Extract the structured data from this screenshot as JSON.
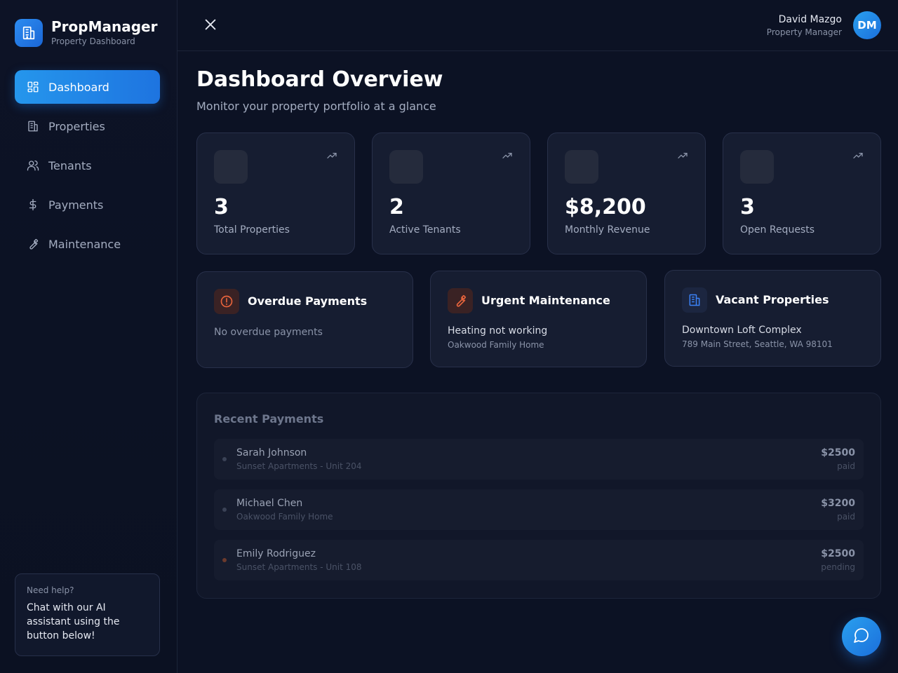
{
  "brand": {
    "title": "PropManager",
    "subtitle": "Property Dashboard",
    "logo_icon": "building-icon"
  },
  "nav": {
    "items": [
      {
        "label": "Dashboard",
        "icon": "grid-icon",
        "active": true
      },
      {
        "label": "Properties",
        "icon": "building-icon",
        "active": false
      },
      {
        "label": "Tenants",
        "icon": "users-icon",
        "active": false
      },
      {
        "label": "Payments",
        "icon": "dollar-icon",
        "active": false
      },
      {
        "label": "Maintenance",
        "icon": "wrench-icon",
        "active": false
      }
    ]
  },
  "help": {
    "title": "Need help?",
    "text": "Chat with our AI assistant using the button below!"
  },
  "header": {
    "close_icon": "close-icon",
    "user_name": "David Mazgo",
    "user_role": "Property Manager",
    "avatar_initials": "DM"
  },
  "page": {
    "title": "Dashboard Overview",
    "subtitle": "Monitor your property portfolio at a glance"
  },
  "stats": [
    {
      "value": "3",
      "label": "Total Properties"
    },
    {
      "value": "2",
      "label": "Active Tenants"
    },
    {
      "value": "$8,200",
      "label": "Monthly Revenue"
    },
    {
      "value": "3",
      "label": "Open Requests"
    }
  ],
  "alerts": {
    "overdue": {
      "title": "Overdue Payments",
      "body": "No overdue payments",
      "icon": "alert-circle-icon",
      "color": "#e8643c"
    },
    "maintenance": {
      "title": "Urgent Maintenance",
      "line1": "Heating not working",
      "line2": "Oakwood Family Home",
      "icon": "wrench-icon",
      "color": "#e8643c"
    },
    "vacant": {
      "title": "Vacant Properties",
      "line1": "Downtown Loft Complex",
      "line2": "789 Main Street, Seattle, WA 98101",
      "icon": "building-icon",
      "color": "#3b82f6"
    }
  },
  "payments": {
    "title": "Recent Payments",
    "rows": [
      {
        "name": "Sarah Johnson",
        "property": "Sunset Apartments - Unit 204",
        "amount": "$2500",
        "status": "paid"
      },
      {
        "name": "Michael Chen",
        "property": "Oakwood Family Home",
        "amount": "$3200",
        "status": "paid"
      },
      {
        "name": "Emily Rodriguez",
        "property": "Sunset Apartments - Unit 108",
        "amount": "$2500",
        "status": "pending"
      }
    ]
  },
  "chat": {
    "icon": "chat-bubble-icon"
  }
}
